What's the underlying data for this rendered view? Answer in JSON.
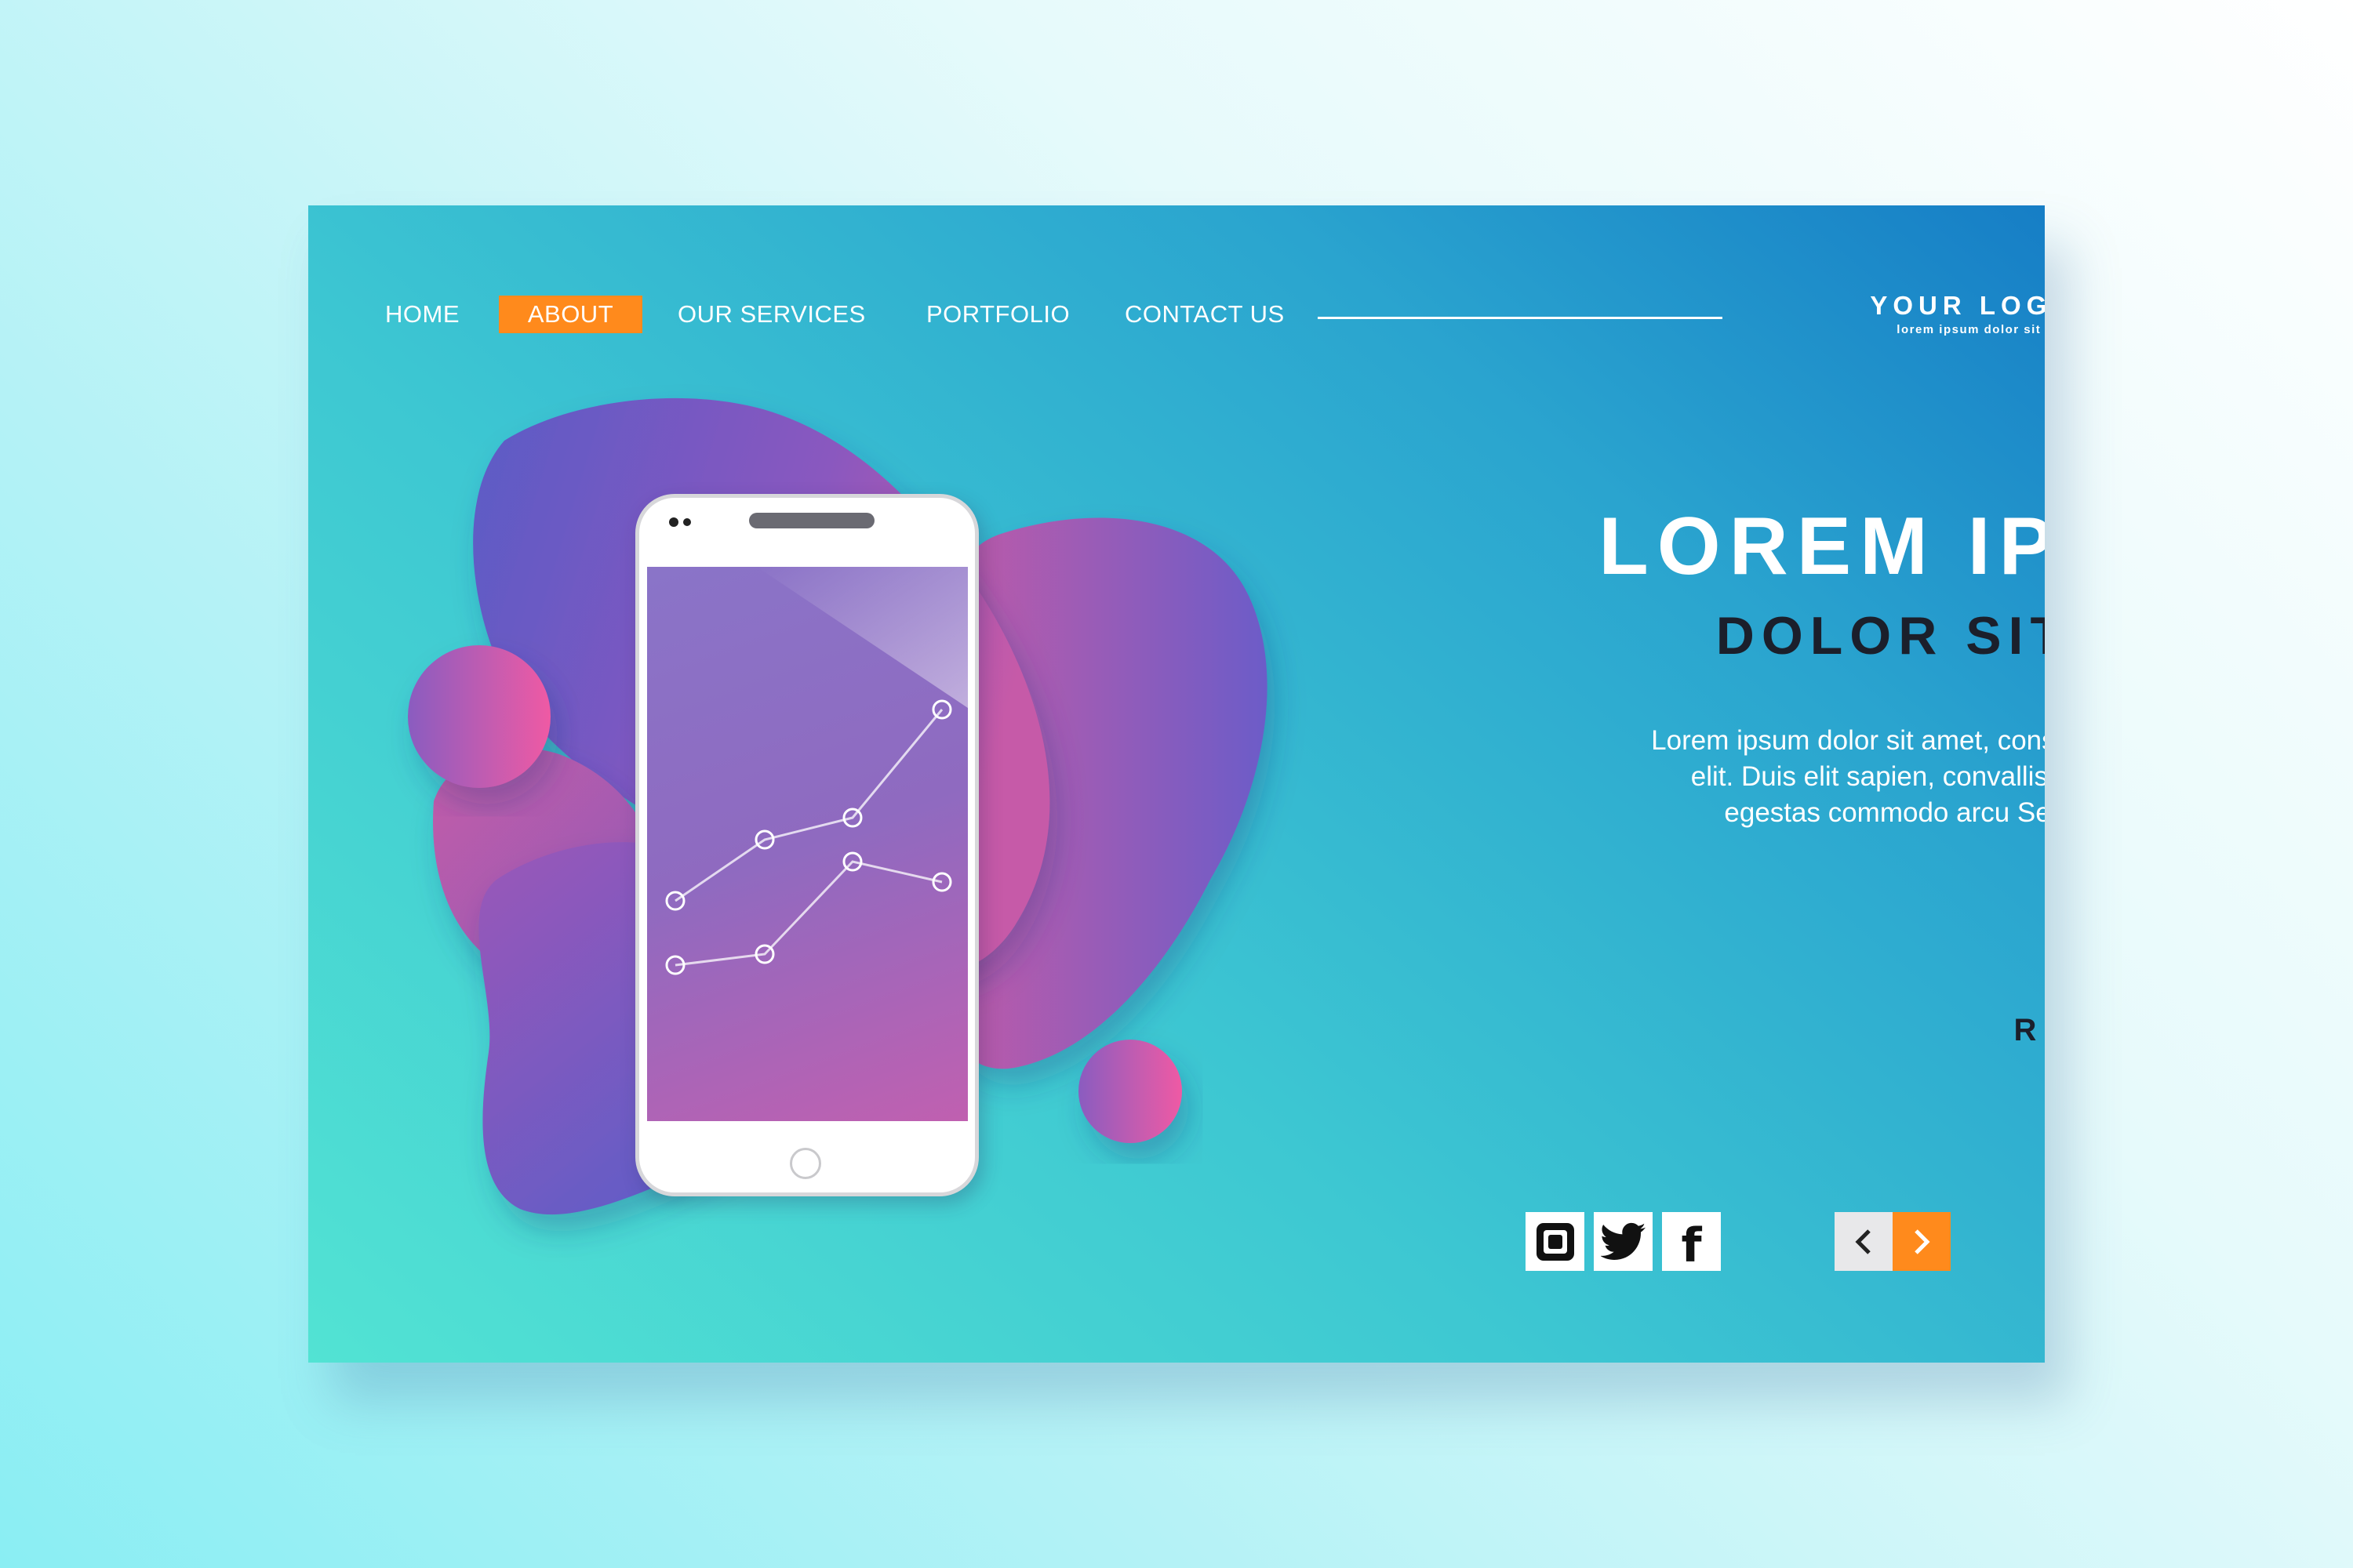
{
  "nav": {
    "items": [
      {
        "label": "HOME",
        "active": false
      },
      {
        "label": "ABOUT",
        "active": true
      },
      {
        "label": "OUR SERVICES",
        "active": false
      },
      {
        "label": "PORTFOLIO",
        "active": false
      },
      {
        "label": "CONTACT US",
        "active": false
      }
    ]
  },
  "logo": {
    "title": "YOUR LOGO",
    "subtitle": "lorem ipsum dolor sit amet"
  },
  "hero": {
    "title": "LOREM IPSUM",
    "subtitle": "DOLOR SIT AMET",
    "body": "Lorem ipsum dolor sit amet, consectetur adipiscing elit. Duis  elit  sapien,  convallis vel  enim  sit amet,  egestas  commodo arcu Sed placerat congue convallis",
    "cta": "READ MORE"
  },
  "social": [
    {
      "icon": "instagram-icon"
    },
    {
      "icon": "twitter-icon"
    },
    {
      "icon": "facebook-icon",
      "glyph": "f"
    }
  ],
  "pager": {
    "prev_icon": "chevron-left-icon",
    "next_icon": "chevron-right-icon"
  },
  "colors": {
    "accent": "#ff8a1c",
    "dark_text": "#1b1f2b",
    "card_gradient_start": "#52e3d3",
    "card_gradient_end": "#167ec6",
    "blob_purple": "#6a5ac8",
    "blob_pink": "#e05aa8"
  }
}
